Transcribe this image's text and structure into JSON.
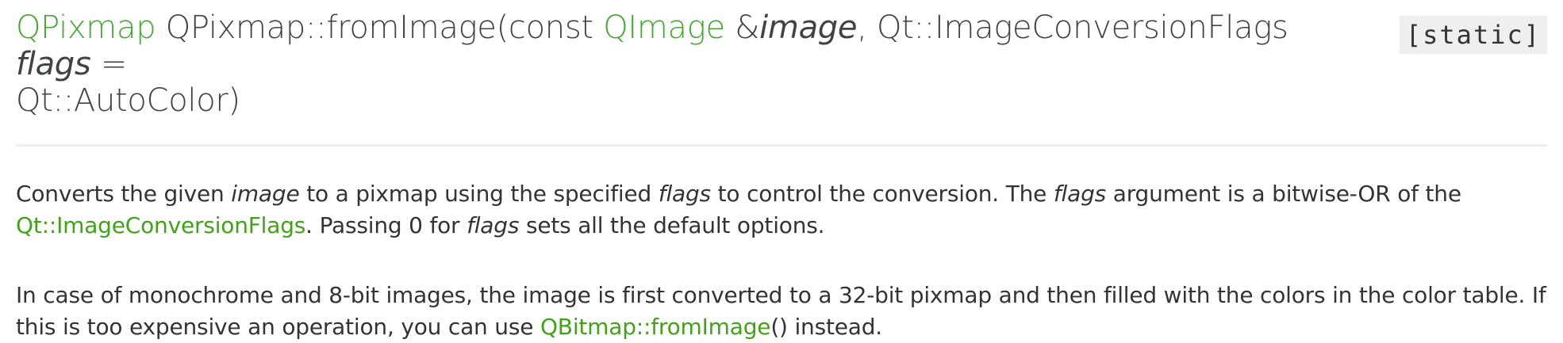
{
  "signature": {
    "return_type": "QPixmap",
    "function_name": "QPixmap::fromImage(const",
    "param1_type": "QImage",
    "param1_ref": "&",
    "param1_name": "image",
    "separator": ",",
    "param2_type": "Qt::ImageConversionFlags",
    "param2_name": "flags",
    "default_eq": "=",
    "default_value": "Qt::AutoColor)",
    "static_tag": "[static]"
  },
  "paragraph1": {
    "t1": "Converts the given",
    "image": "image",
    "t2": "to a pixmap using the specified",
    "flags1": "flags",
    "t3": "to control the conversion. The",
    "flags2": "flags",
    "t4": "argument is a bitwise-OR of the",
    "link": "Qt::ImageConversionFlags",
    "t5": ". Passing 0 for",
    "flags3": "flags",
    "t6": "sets all the default options."
  },
  "paragraph2": {
    "t1": "In case of monochrome and 8-bit images, the image is first converted to a 32-bit pixmap and then filled with the colors in the color table. If this is too expensive an operation, you can use",
    "link": "QBitmap::fromImage",
    "t2": "() instead."
  },
  "colors": {
    "link": "#41a317",
    "text": "#333333",
    "static_bg": "#efefef",
    "rule": "#eeeeee"
  }
}
